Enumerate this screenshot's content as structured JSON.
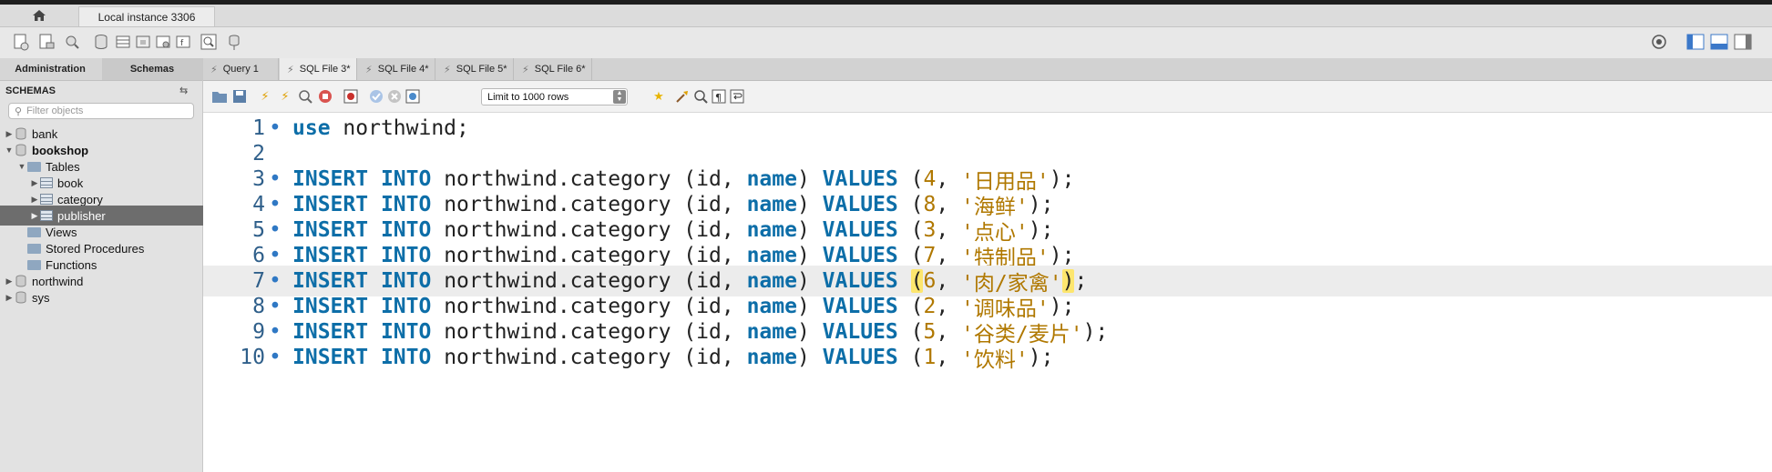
{
  "window": {
    "connection_tab": "Local instance 3306"
  },
  "left_panel": {
    "tabs": [
      "Administration",
      "Schemas"
    ],
    "header": "SCHEMAS",
    "filter_placeholder": "Filter objects",
    "tree": [
      {
        "label": "bank",
        "level": 0,
        "kind": "db",
        "expanded": false,
        "bold": false
      },
      {
        "label": "bookshop",
        "level": 0,
        "kind": "db",
        "expanded": true,
        "bold": true
      },
      {
        "label": "Tables",
        "level": 1,
        "kind": "folder",
        "expanded": true
      },
      {
        "label": "book",
        "level": 2,
        "kind": "table",
        "expanded": false
      },
      {
        "label": "category",
        "level": 2,
        "kind": "table",
        "expanded": false
      },
      {
        "label": "publisher",
        "level": 2,
        "kind": "table",
        "expanded": false,
        "selected": true
      },
      {
        "label": "Views",
        "level": 1,
        "kind": "folder"
      },
      {
        "label": "Stored Procedures",
        "level": 1,
        "kind": "folder"
      },
      {
        "label": "Functions",
        "level": 1,
        "kind": "folder"
      },
      {
        "label": "northwind",
        "level": 0,
        "kind": "db",
        "expanded": false
      },
      {
        "label": "sys",
        "level": 0,
        "kind": "db",
        "expanded": false
      }
    ]
  },
  "editor_tabs": [
    "Query 1",
    "SQL File 3*",
    "SQL File 4*",
    "SQL File 5*",
    "SQL File 6*"
  ],
  "active_editor_tab": "SQL File 3*",
  "limit_select": {
    "value": "Limit to 1000 rows"
  },
  "colors": {
    "keyword": "#0d6ea8",
    "string": "#b07800",
    "line_number": "#2f5f8a",
    "bracket_highlight": "#fde66e"
  },
  "code_lines": [
    {
      "n": "1",
      "use_db": "northwind"
    },
    {
      "n": "2"
    },
    {
      "n": "3",
      "id": "4",
      "name": "'日用品'"
    },
    {
      "n": "4",
      "id": "8",
      "name": "'海鲜'"
    },
    {
      "n": "5",
      "id": "3",
      "name": "'点心'"
    },
    {
      "n": "6",
      "id": "7",
      "name": "'特制品'"
    },
    {
      "n": "7",
      "id": "6",
      "name": "'肉/家禽'",
      "current": true
    },
    {
      "n": "8",
      "id": "2",
      "name": "'调味品'"
    },
    {
      "n": "9",
      "id": "5",
      "name": "'谷类/麦片'"
    },
    {
      "n": "10",
      "id": "1",
      "name": "'饮料'"
    }
  ],
  "sql_tokens": {
    "use_kw": "use",
    "insert_kw": "INSERT",
    "into_kw": "INTO",
    "table": "northwind.category",
    "id_col": "id",
    "name_col": "name",
    "values_kw": "VALUES"
  }
}
